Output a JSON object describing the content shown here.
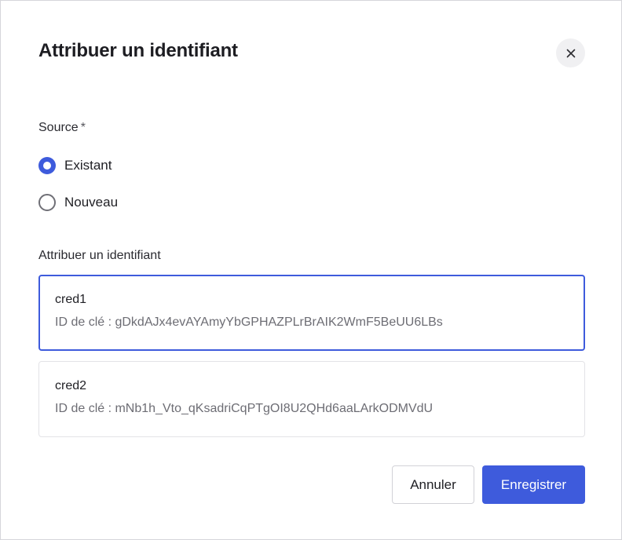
{
  "dialog": {
    "title": "Attribuer un identifiant",
    "close_icon": "close-icon"
  },
  "source": {
    "label": "Source",
    "required_marker": "*",
    "options": [
      {
        "label": "Existant",
        "checked": true
      },
      {
        "label": "Nouveau",
        "checked": false
      }
    ]
  },
  "credentials": {
    "label": "Attribuer un identifiant",
    "items": [
      {
        "name": "cred1",
        "key_id": "ID de clé : gDkdAJx4evAYAmyYbGPHAZPLrBrAIK2WmF5BeUU6LBs",
        "selected": true
      },
      {
        "name": "cred2",
        "key_id": "ID de clé : mNb1h_Vto_qKsadriCqPTgOI8U2QHd6aaLArkODMVdU",
        "selected": false
      }
    ]
  },
  "footer": {
    "cancel_label": "Annuler",
    "save_label": "Enregistrer"
  },
  "colors": {
    "accent": "#3e5bdc",
    "text": "#1f1f24",
    "muted": "#6d6d74",
    "border": "#e3e3e7"
  }
}
